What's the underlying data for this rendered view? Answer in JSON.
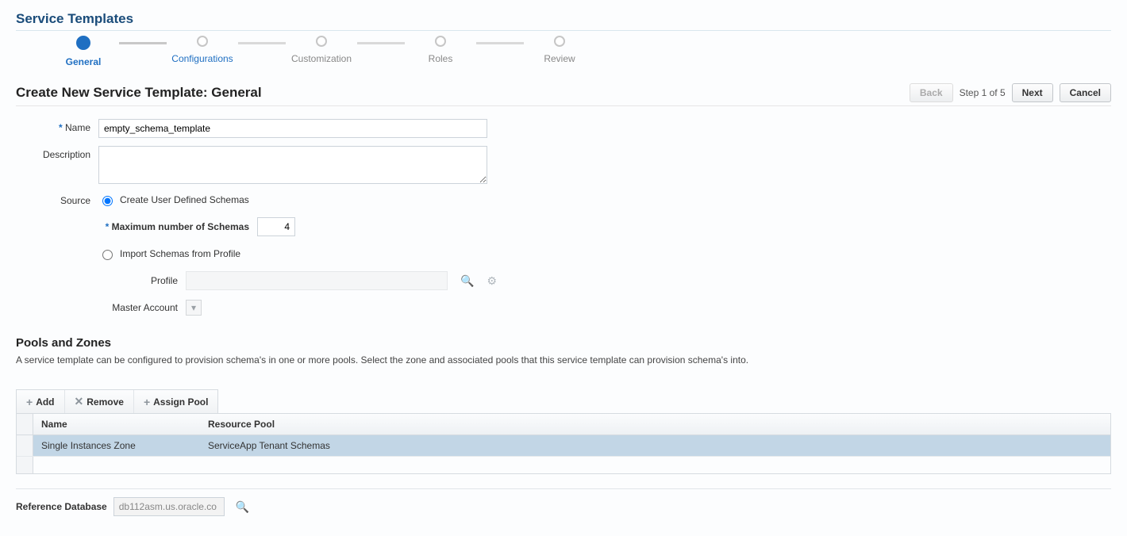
{
  "pageTitle": "Service Templates",
  "stepper": {
    "steps": [
      "General",
      "Configurations",
      "Customization",
      "Roles",
      "Review"
    ],
    "activeIndex": 0
  },
  "wizard": {
    "heading": "Create New Service Template: General",
    "stepLabel": "Step 1 of 5",
    "backLabel": "Back",
    "nextLabel": "Next",
    "cancelLabel": "Cancel"
  },
  "form": {
    "nameLabel": "Name",
    "nameValue": "empty_schema_template",
    "descLabel": "Description",
    "descValue": "",
    "sourceLabel": "Source",
    "sourceOptions": {
      "createLabel": "Create User Defined Schemas",
      "importLabel": "Import Schemas from Profile",
      "selected": "create"
    },
    "maxSchemasLabel": "Maximum number of Schemas",
    "maxSchemasValue": "4",
    "profileLabel": "Profile",
    "masterAccountLabel": "Master Account"
  },
  "poolsZones": {
    "title": "Pools and Zones",
    "help": "A service template can be configured to provision schema's in one or more pools. Select the zone and associated pools that this service template can provision schema's into.",
    "toolbar": {
      "add": "Add",
      "remove": "Remove",
      "assign": "Assign Pool"
    },
    "columns": {
      "name": "Name",
      "pool": "Resource Pool"
    },
    "rows": [
      {
        "name": "Single Instances Zone",
        "pool": "ServiceApp Tenant Schemas"
      }
    ]
  },
  "referenceDb": {
    "label": "Reference Database",
    "value": "db112asm.us.oracle.co"
  }
}
